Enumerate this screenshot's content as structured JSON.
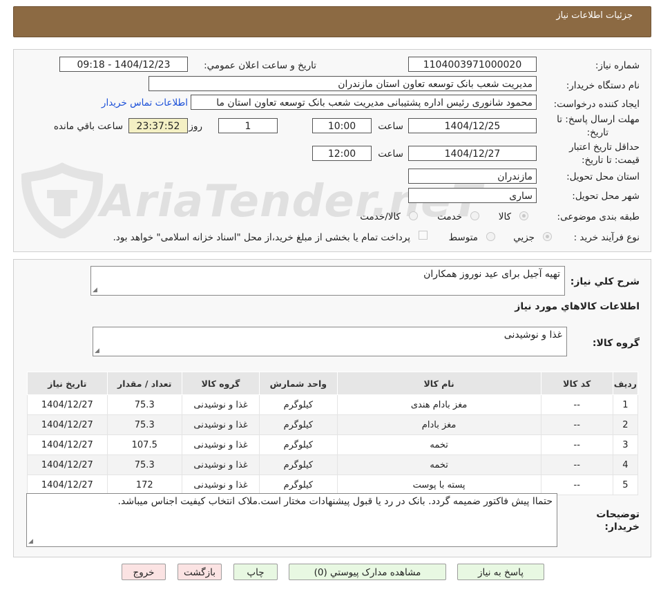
{
  "header": {
    "title": "جزئیات اطلاعات نیاز"
  },
  "fields": {
    "need_number_label": "شماره نیاز:",
    "need_number": "1104003971000020",
    "announce_label": "تاریخ و ساعت اعلان عمومي:",
    "announce_value": "1404/12/23 - 09:18",
    "buyer_label": "نام دستگاه خريدار:",
    "buyer_value": "مدیریت شعب بانک توسعه تعاون استان مازندران",
    "requester_label": "ايجاد کننده درخواست:",
    "requester_value": "محمود شانوری رئیس اداره پشتیبانی مدیریت شعب بانک توسعه تعاون استان ما",
    "contact_link": "اطلاعات تماس خريدار",
    "deadline_label_1": "مهلت ارسال پاسخ: تا",
    "deadline_label_2": "تاريخ:",
    "deadline_date": "1404/12/25",
    "time_label": "ساعت",
    "deadline_time": "10:00",
    "days_value": "1",
    "days_label": "روز و",
    "remaining_time": "23:37:52",
    "remaining_label": "ساعت باقي مانده",
    "validity_label_1": "حداقل تاريخ اعتبار",
    "validity_label_2": "قيمت: تا تاريخ:",
    "validity_date": "1404/12/27",
    "validity_time": "12:00",
    "province_label": "استان محل تحويل:",
    "province_value": "مازندران",
    "city_label": "شهر محل تحويل:",
    "city_value": "ساری",
    "category_label": "طبقه بندی موضوعی:",
    "category_options": [
      "کالا",
      "خدمت",
      "کالا/خدمت"
    ],
    "category_selected": "کالا",
    "process_label": "نوع فرآيند خريد :",
    "process_options": [
      "جزيي",
      "متوسط"
    ],
    "payment_note": "پرداخت تمام یا بخشی از مبلغ خرید،از محل \"اسناد خزانه اسلامی\" خواهد بود."
  },
  "description": {
    "label": "شرح کلي نياز:",
    "value": "تهیه آجیل برای عید نوروز  همکاران"
  },
  "goods_section": {
    "title": "اطلاعات کالاهاي مورد نياز",
    "group_label": "گروه کالا:",
    "group_value": "غذا و نوشیدنی"
  },
  "table": {
    "headers": [
      "رديف",
      "کد کالا",
      "نام کالا",
      "واحد شمارش",
      "گروه کالا",
      "تعداد / مقدار",
      "تاريخ نياز"
    ],
    "rows": [
      [
        "1",
        "--",
        "مغز بادام هندی",
        "کیلوگرم",
        "غذا و نوشیدنی",
        "75.3",
        "1404/12/27"
      ],
      [
        "2",
        "--",
        "مغز بادام",
        "کیلوگرم",
        "غذا و نوشیدنی",
        "75.3",
        "1404/12/27"
      ],
      [
        "3",
        "--",
        "تخمه",
        "کیلوگرم",
        "غذا و نوشیدنی",
        "107.5",
        "1404/12/27"
      ],
      [
        "4",
        "--",
        "تخمه",
        "کیلوگرم",
        "غذا و نوشیدنی",
        "75.3",
        "1404/12/27"
      ],
      [
        "5",
        "--",
        "پسته با پوست",
        "کیلوگرم",
        "غذا و نوشیدنی",
        "172",
        "1404/12/27"
      ]
    ]
  },
  "buyer_notes": {
    "label_1": "توضيحات",
    "label_2": "خريدار:",
    "value": "حتماا پیش فاکتور ضمیمه گردد. بانک در رد یا قبول پیشنهادات مختار است.ملاک انتخاب کیفیت اجناس میباشد."
  },
  "buttons": {
    "reply": "پاسخ به نياز",
    "attachments": "مشاهده مدارک پيوستي (0)",
    "print": "چاپ",
    "back": "بازگشت",
    "exit": "خروج"
  },
  "watermark": {
    "text": "AriaTender.neT"
  },
  "colors": {
    "header_bg": "#8c6a43",
    "link": "#1a4fd8",
    "remaining_bg": "#f4f0c4"
  }
}
